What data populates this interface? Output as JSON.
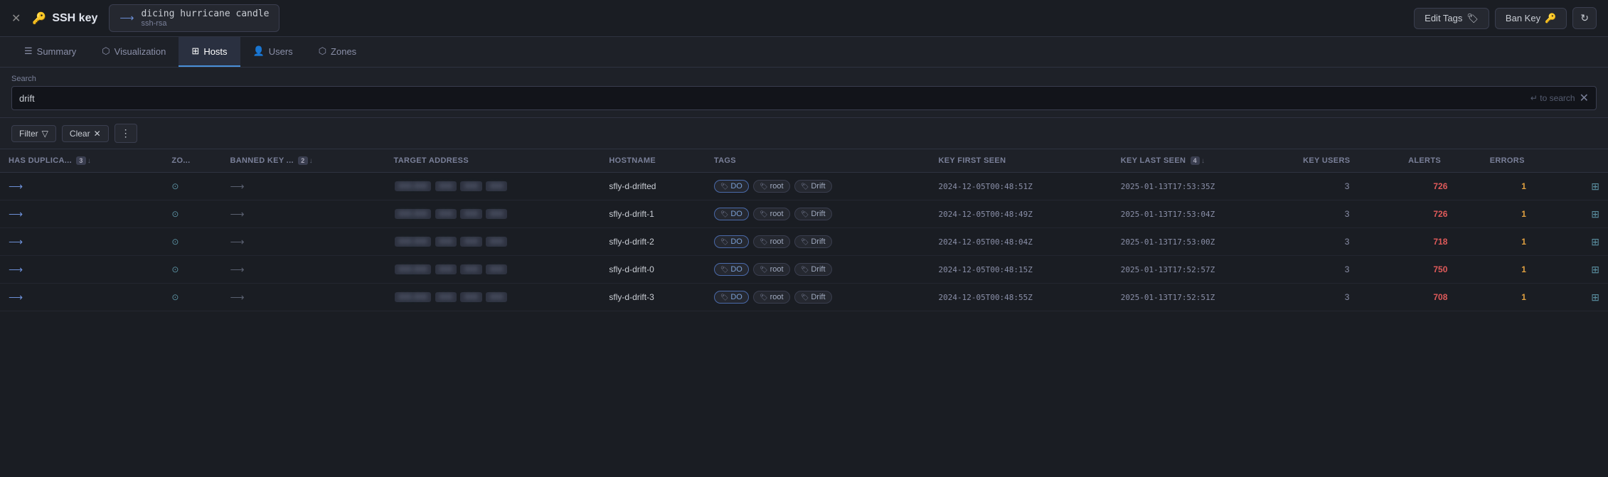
{
  "header": {
    "close_label": "✕",
    "title": "SSH key",
    "key_icon": "⟶",
    "key_name": "dicing hurricane candle",
    "key_type": "ssh-rsa",
    "edit_tags_label": "Edit Tags",
    "ban_key_label": "Ban Key",
    "refresh_icon": "↻"
  },
  "tabs": [
    {
      "id": "summary",
      "label": "Summary",
      "icon": "☰",
      "active": false
    },
    {
      "id": "visualization",
      "label": "Visualization",
      "icon": "⬡",
      "active": false
    },
    {
      "id": "hosts",
      "label": "Hosts",
      "icon": "⊞",
      "active": true
    },
    {
      "id": "users",
      "label": "Users",
      "icon": "👤",
      "active": false
    },
    {
      "id": "zones",
      "label": "Zones",
      "icon": "⬡",
      "active": false
    }
  ],
  "search": {
    "label": "Search",
    "value": "drift",
    "hint": "↵  to search",
    "placeholder": ""
  },
  "filter_bar": {
    "filter_label": "Filter",
    "clear_label": "Clear",
    "more_label": "⋮"
  },
  "table": {
    "columns": [
      {
        "id": "has_duplicates",
        "label": "HAS DUPLICA...",
        "sort_badge": "3",
        "arrow": "↓"
      },
      {
        "id": "zones",
        "label": "ZO...",
        "arrow": ""
      },
      {
        "id": "banned_key",
        "label": "BANNED KEY ...",
        "sort_badge": "2",
        "arrow": "↓"
      },
      {
        "id": "target_address",
        "label": "TARGET ADDRESS",
        "arrow": ""
      },
      {
        "id": "hostname",
        "label": "HOSTNAME",
        "arrow": ""
      },
      {
        "id": "tags",
        "label": "TAGS",
        "arrow": ""
      },
      {
        "id": "key_first_seen",
        "label": "KEY FIRST SEEN",
        "arrow": ""
      },
      {
        "id": "key_last_seen",
        "label": "KEY LAST SEEN",
        "sort_badge": "4",
        "arrow": "↓"
      },
      {
        "id": "key_users",
        "label": "KEY USERS",
        "arrow": ""
      },
      {
        "id": "alerts",
        "label": "ALERTS",
        "arrow": ""
      },
      {
        "id": "errors",
        "label": "ERRORS",
        "arrow": ""
      },
      {
        "id": "actions",
        "label": "",
        "arrow": ""
      }
    ],
    "rows": [
      {
        "has_duplicates_icon": "⟶",
        "zones_icon": "⊙",
        "banned_icon": "⟶",
        "target_address": "█ █ █ █",
        "hostname": "sfly-d-drifted",
        "tags": [
          "DO",
          "root",
          "Drift"
        ],
        "key_first_seen": "2024-12-05T00:48:51Z",
        "key_last_seen": "2025-01-13T17:53:35Z",
        "key_users": 3,
        "alerts": 726,
        "errors": 1
      },
      {
        "has_duplicates_icon": "⟶",
        "zones_icon": "⊙",
        "banned_icon": "⟶",
        "target_address": "█ █ █ █",
        "hostname": "sfly-d-drift-1",
        "tags": [
          "DO",
          "root",
          "Drift"
        ],
        "key_first_seen": "2024-12-05T00:48:49Z",
        "key_last_seen": "2025-01-13T17:53:04Z",
        "key_users": 3,
        "alerts": 726,
        "errors": 1
      },
      {
        "has_duplicates_icon": "⟶",
        "zones_icon": "⊙",
        "banned_icon": "⟶",
        "target_address": "█ █ █ █",
        "hostname": "sfly-d-drift-2",
        "tags": [
          "DO",
          "root",
          "Drift"
        ],
        "key_first_seen": "2024-12-05T00:48:04Z",
        "key_last_seen": "2025-01-13T17:53:00Z",
        "key_users": 3,
        "alerts": 718,
        "errors": 1
      },
      {
        "has_duplicates_icon": "⟶",
        "zones_icon": "⊙",
        "banned_icon": "⟶",
        "target_address": "█ █ █ █",
        "hostname": "sfly-d-drift-0",
        "tags": [
          "DO",
          "root",
          "Drift"
        ],
        "key_first_seen": "2024-12-05T00:48:15Z",
        "key_last_seen": "2025-01-13T17:52:57Z",
        "key_users": 3,
        "alerts": 750,
        "errors": 1
      },
      {
        "has_duplicates_icon": "⟶",
        "zones_icon": "⊙",
        "banned_icon": "⟶",
        "target_address": "█ █ █ █",
        "hostname": "sfly-d-drift-3",
        "tags": [
          "DO",
          "root",
          "Drift"
        ],
        "key_first_seen": "2024-12-05T00:48:55Z",
        "key_last_seen": "2025-01-13T17:52:51Z",
        "key_users": 3,
        "alerts": 708,
        "errors": 1
      }
    ]
  }
}
